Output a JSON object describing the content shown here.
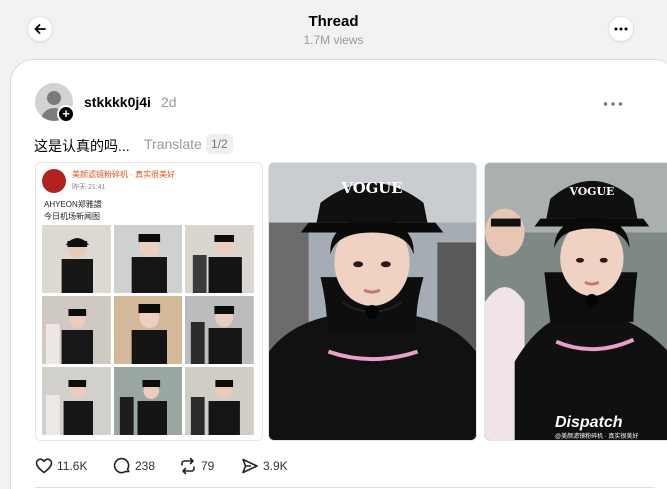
{
  "header": {
    "title": "Thread",
    "views": "1.7M views"
  },
  "post": {
    "username": "stkkkk0j4i",
    "timestamp": "2d",
    "text": "这是认真的吗...",
    "translate_label": "Translate",
    "page_indicator": "1/2",
    "embedded_post": {
      "account_name": "美颜滤镜粉碎机 · 真实很美好",
      "time": "昨天 21:41",
      "line1": "AHYEON郑雅譞",
      "line2": "今日机场新闻图"
    },
    "photo_text": {
      "cap_brand": "VOGUE",
      "watermark": "Dispatch",
      "watermark_sub": "@美颜滤镜粉碎机 · 真实很美好"
    },
    "stats": {
      "likes": "11.6K",
      "replies": "238",
      "reposts": "79",
      "shares": "3.9K"
    }
  }
}
